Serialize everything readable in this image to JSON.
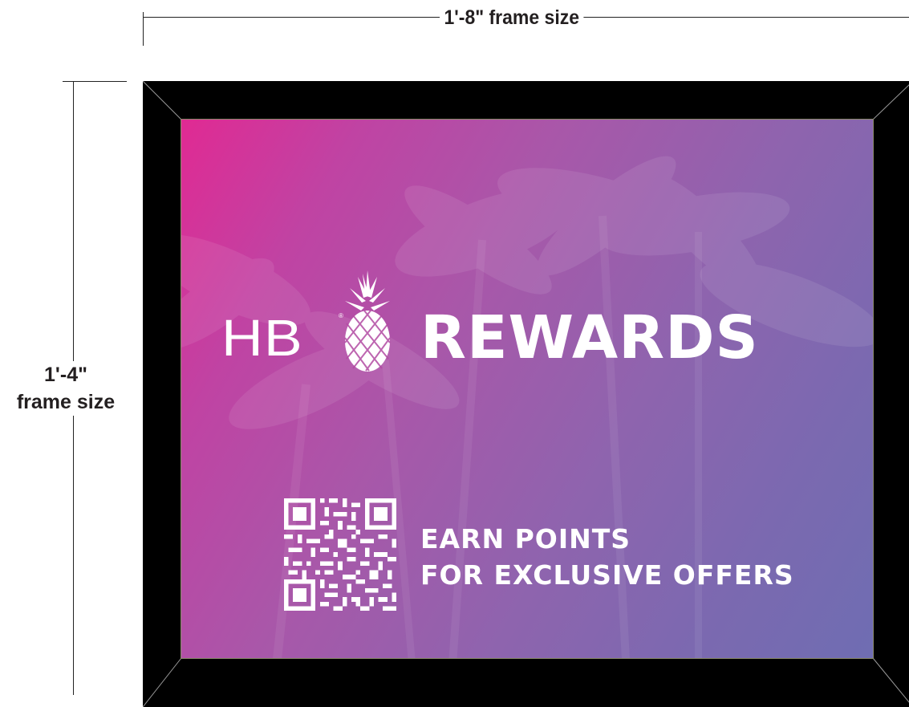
{
  "dimensions": {
    "width_label": "1'-8\" frame size",
    "height_label_line1": "1'-4\"",
    "height_label_line2": "frame size"
  },
  "sign": {
    "logo_hb": "HB",
    "logo_registered": "®",
    "logo_rewards": "REWARDS",
    "logo_icon": "pineapple-icon",
    "tagline_line1": "EARN POINTS",
    "tagline_line2": "FOR EXCLUSIVE OFFERS",
    "qr_icon": "qr-code-icon",
    "background": "palm-trees-photo",
    "colors": {
      "gradient_start": "#e02a93",
      "gradient_end": "#6f6db2",
      "frame": "#000000",
      "text": "#ffffff"
    }
  }
}
